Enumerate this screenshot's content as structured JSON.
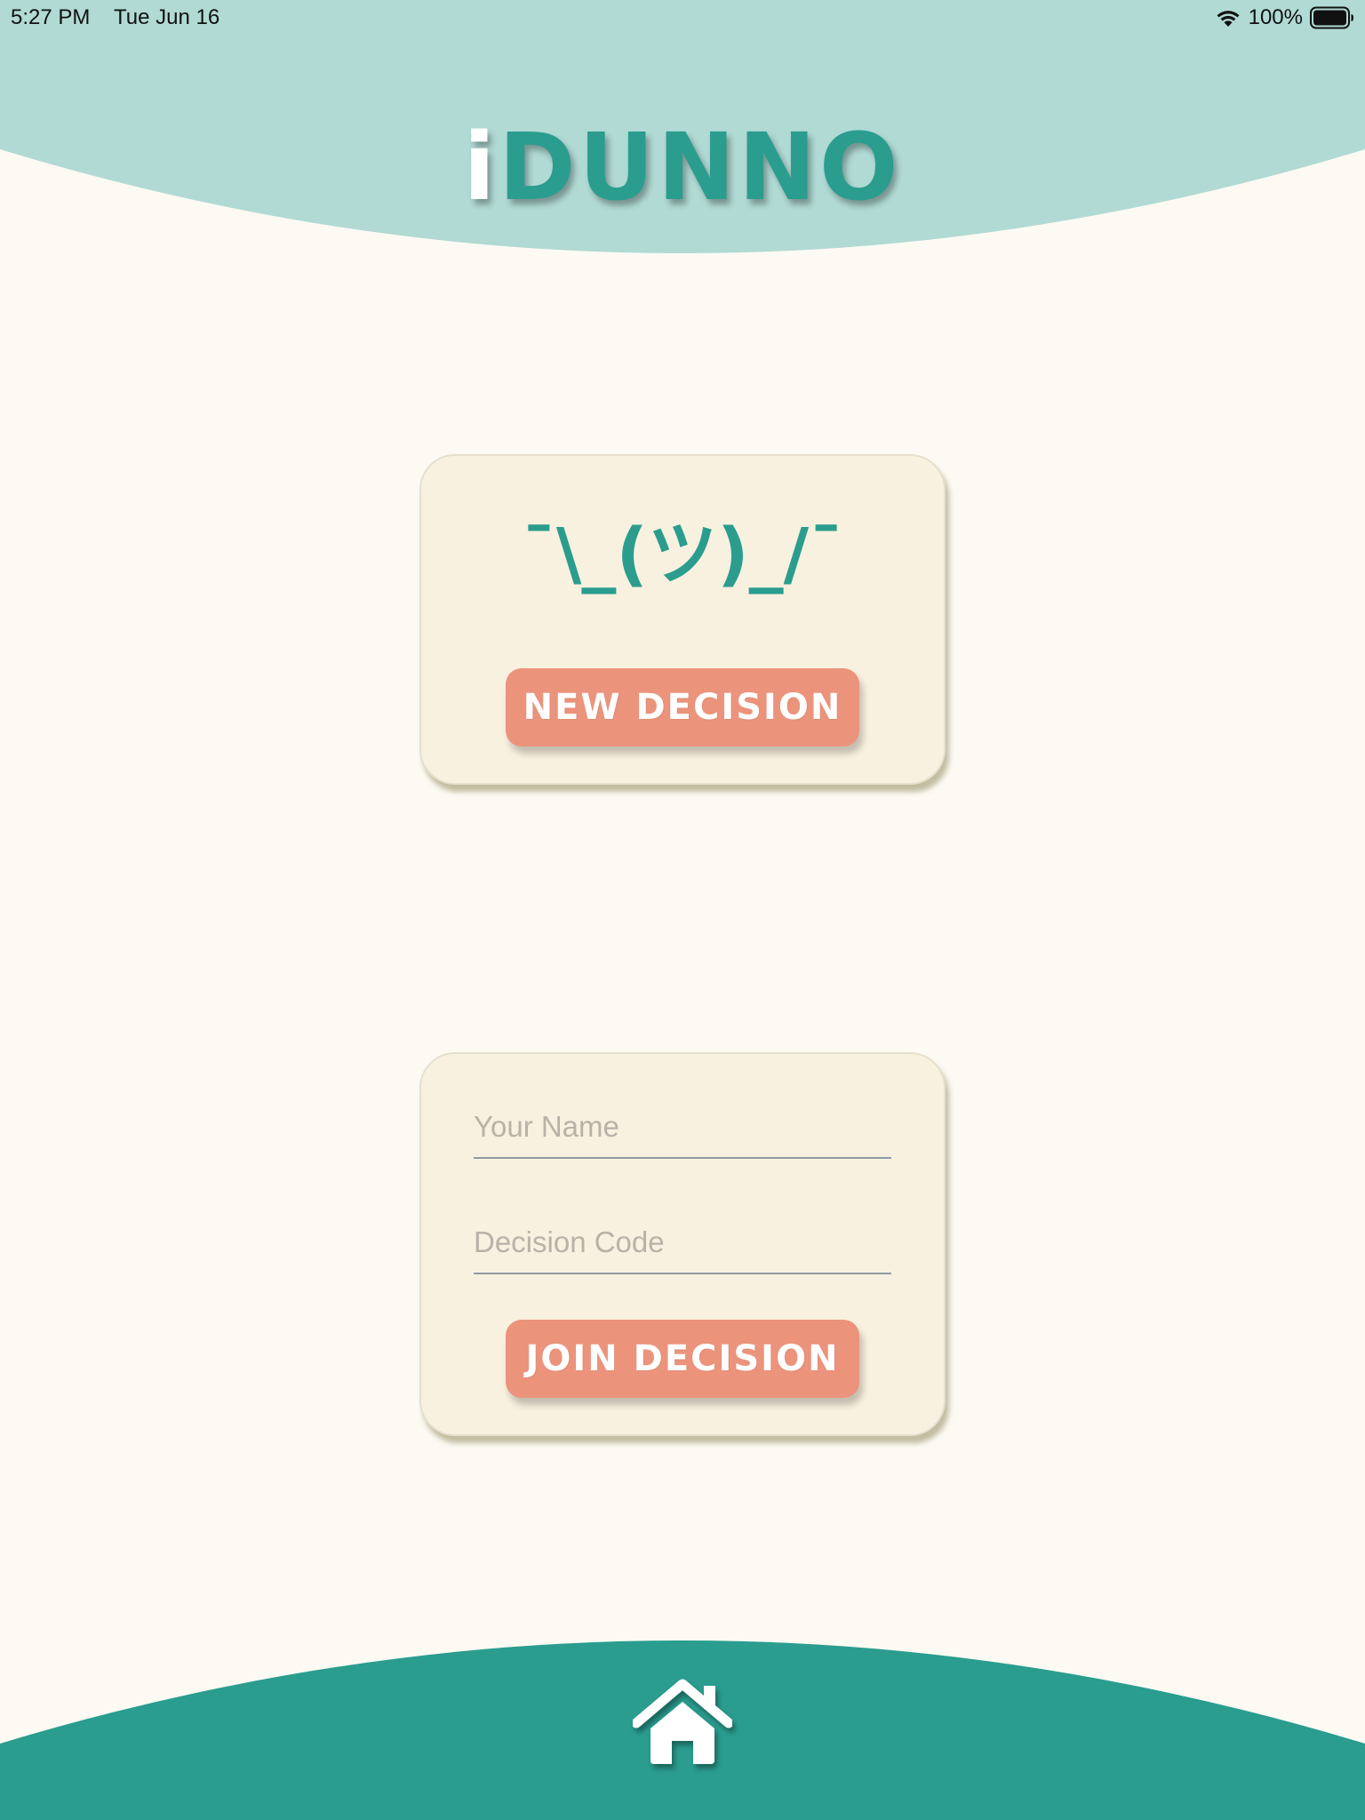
{
  "status_bar": {
    "time": "5:27 PM",
    "date": "Tue Jun 16",
    "battery_percent": "100%",
    "icons": [
      "wifi-icon",
      "battery-icon"
    ]
  },
  "header": {
    "title_prefix": "i",
    "title_main": "DUNNO"
  },
  "new_decision_card": {
    "emoticon": "¯\\_(ツ)_/¯",
    "button_label": "NEW DECISION"
  },
  "join_decision_card": {
    "name_field": {
      "value": "",
      "placeholder": "Your Name"
    },
    "code_field": {
      "value": "",
      "placeholder": "Decision Code"
    },
    "button_label": "JOIN DECISION"
  },
  "footer": {
    "home_icon": "home-icon"
  },
  "colors": {
    "background": "#fcfaf3",
    "header_band": "#b1dad4",
    "footer_band": "#2a9d8f",
    "teal": "#2a9d8f",
    "card": "#f9f1df",
    "button": "#ec937c"
  }
}
